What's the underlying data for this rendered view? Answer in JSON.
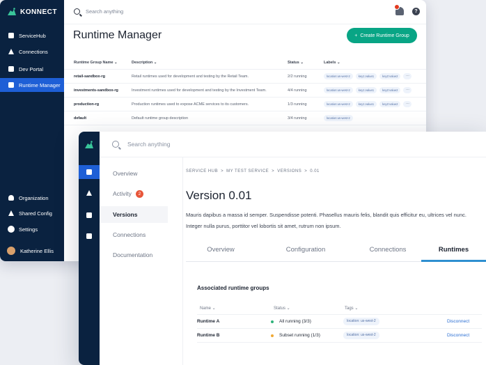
{
  "back": {
    "brand": "KONNECT",
    "nav": [
      {
        "label": "ServiceHub"
      },
      {
        "label": "Connections"
      },
      {
        "label": "Dev Portal"
      },
      {
        "label": "Runtime Manager",
        "active": true
      }
    ],
    "bottom_nav": [
      {
        "label": "Organization"
      },
      {
        "label": "Shared Config"
      },
      {
        "label": "Settings"
      }
    ],
    "user_name": "Katherine Ellis",
    "search_placeholder": "Search anything",
    "notification_color": "#e3391e",
    "help_glyph": "?",
    "page_title": "Runtime Manager",
    "create_button": "Create Runtime Group",
    "create_button_plus": "+",
    "table": {
      "headers": {
        "name": "Runtime Group Name ⌄",
        "description": "Description ⌄",
        "status": "Status ⌄",
        "labels": "Labels ⌄"
      },
      "rows": [
        {
          "name": "retail-sandbox-rg",
          "description": "Retail runtimes used for development and testing by the Retail Team.",
          "status": "2/2 running",
          "labels": [
            "location:us-west-2",
            "key1:value1",
            "key2:value2"
          ],
          "more": "···"
        },
        {
          "name": "investments-sandbox-rg",
          "description": "Investment runtimes used for development and testing by the Investment Team.",
          "status": "4/4 running",
          "labels": [
            "location:us-west-2",
            "key1:value1",
            "key2:value2"
          ],
          "more": "···"
        },
        {
          "name": "production-rg",
          "description": "Production runtimes used to expose ACME services to its customers.",
          "status": "1/3 running",
          "labels": [
            "location:us-west-2",
            "key1:value1",
            "key2:value2"
          ],
          "more": "···"
        },
        {
          "name": "default",
          "description": "Default runtime group description",
          "status": "3/4 running",
          "labels": [
            "location:us-west-2"
          ],
          "more": ""
        }
      ]
    }
  },
  "front": {
    "search_placeholder": "Search anything",
    "nav": [
      {
        "label": "Overview"
      },
      {
        "label": "Activity",
        "badge": "2"
      },
      {
        "label": "Versions",
        "active": true
      },
      {
        "label": "Connections"
      },
      {
        "label": "Documentation"
      }
    ],
    "breadcrumb": [
      "SERVICE HUB",
      "MY TEST SERVICE",
      "VERSIONS",
      "0.01"
    ],
    "breadcrumb_sep": ">",
    "version_title": "Version 0.01",
    "description": "Mauris dapibus a massa id semper. Suspendisse potenti. Phasellus mauris felis, blandit quis efficitur eu, ultrices vel nunc. Integer nulla purus, porttitor vel lobortis sit amet, rutrum non ipsum.",
    "tabs": [
      {
        "label": "Overview"
      },
      {
        "label": "Configuration"
      },
      {
        "label": "Connections"
      },
      {
        "label": "Runtimes",
        "active": true
      }
    ],
    "card": {
      "title": "Associated runtime groups",
      "headers": {
        "name": "Name ⌄",
        "status": "Status ⌄",
        "tags": "Tags ⌄"
      },
      "rows": [
        {
          "name": "Runtime A",
          "status": "All running (3/3)",
          "status_color": "#2fb37b",
          "tag": "location: us-west-2",
          "action": "Disconnect"
        },
        {
          "name": "Runtime B",
          "status": "Subset running (1/3)",
          "status_color": "#f0a935",
          "tag": "location: us-west-2",
          "action": "Disconnect"
        }
      ]
    }
  },
  "colors": {
    "sidebar": "#0a2240",
    "active_nav": "#1e5fd6",
    "primary_button": "#08a585",
    "tab_underline": "#2e8fd0",
    "link": "#2b6fd3"
  }
}
